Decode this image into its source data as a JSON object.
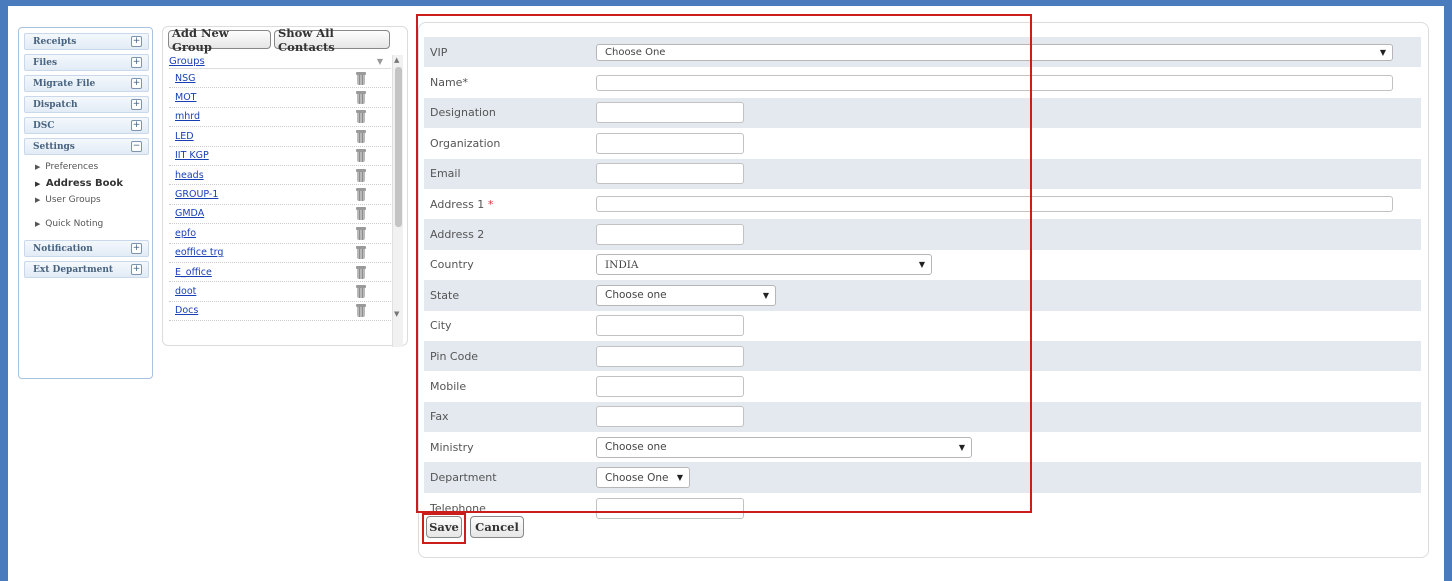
{
  "sidebar": {
    "sections": [
      {
        "label": "Receipts",
        "toggle": "+"
      },
      {
        "label": "Files",
        "toggle": "+"
      },
      {
        "label": "Migrate File",
        "toggle": "+"
      },
      {
        "label": "Dispatch",
        "toggle": "+"
      },
      {
        "label": "DSC",
        "toggle": "+"
      },
      {
        "label": "Settings",
        "toggle": "−"
      },
      {
        "label": "Notification",
        "toggle": "+"
      },
      {
        "label": "Ext Department",
        "toggle": "+"
      }
    ],
    "settings_items": [
      "Preferences",
      "Address Book",
      "User Groups",
      "Quick Noting"
    ],
    "active_item": "Address Book"
  },
  "groups_panel": {
    "add_group_label": "Add New Group",
    "show_all_label": "Show All Contacts",
    "header": "Groups",
    "groups": [
      "NSG",
      "MOT",
      "mhrd",
      "LED",
      "IIT KGP",
      "heads",
      "GROUP-1",
      "GMDA",
      "epfo",
      "eoffice trg",
      "E_office",
      "doot",
      "Docs"
    ]
  },
  "form": {
    "vip": {
      "label": "VIP",
      "value": "Choose One"
    },
    "name": {
      "label": "Name*"
    },
    "designation": {
      "label": "Designation"
    },
    "organization": {
      "label": "Organization"
    },
    "email": {
      "label": "Email"
    },
    "address1": {
      "label": "Address 1",
      "required_mark": "*"
    },
    "address2": {
      "label": "Address 2"
    },
    "country": {
      "label": "Country",
      "value": "INDIA"
    },
    "state": {
      "label": "State",
      "value": "Choose one"
    },
    "city": {
      "label": "City"
    },
    "pincode": {
      "label": "Pin Code"
    },
    "mobile": {
      "label": "Mobile"
    },
    "fax": {
      "label": "Fax"
    },
    "ministry": {
      "label": "Ministry",
      "value": "Choose one"
    },
    "department": {
      "label": "Department",
      "value": "Choose One"
    },
    "telephone": {
      "label": "Telephone"
    }
  },
  "actions": {
    "save_label": "Save",
    "cancel_label": "Cancel"
  },
  "colors": {
    "frame": "#4a7bbd",
    "highlight": "#cc1d1d",
    "row_shade": "#e4e9f0",
    "link": "#1a3fb5"
  }
}
